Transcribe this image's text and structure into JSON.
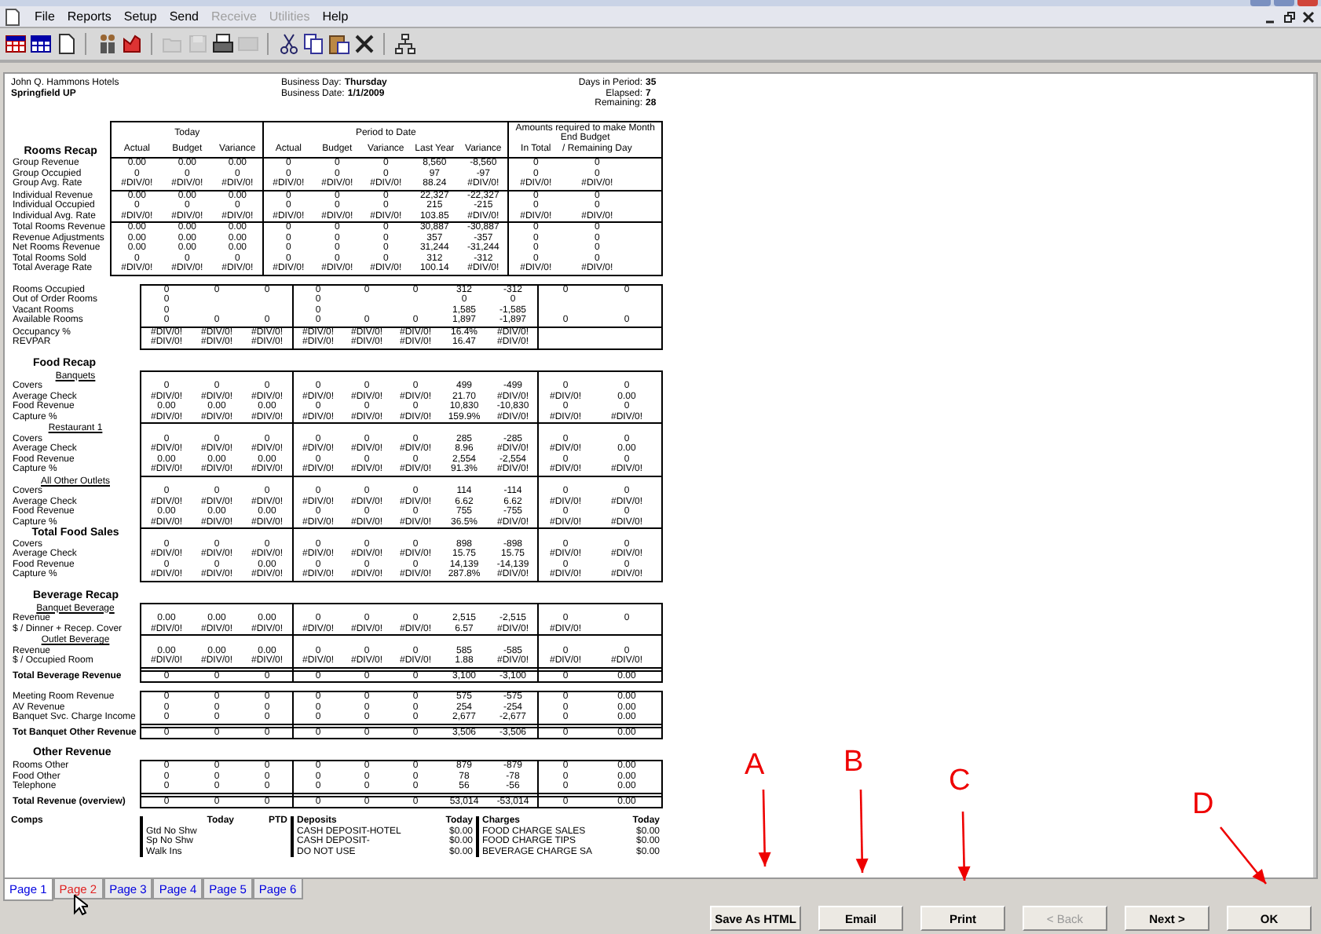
{
  "menu": [
    {
      "label": "File",
      "disabled": false
    },
    {
      "label": "Reports",
      "disabled": false
    },
    {
      "label": "Setup",
      "disabled": false
    },
    {
      "label": "Send",
      "disabled": false
    },
    {
      "label": "Receive",
      "disabled": true
    },
    {
      "label": "Utilities",
      "disabled": true
    },
    {
      "label": "Help",
      "disabled": false
    }
  ],
  "toolbar": [
    {
      "disabled": false
    },
    {
      "disabled": false
    },
    {
      "disabled": false
    },
    {
      "disabled": false
    },
    {
      "disabled": false
    },
    {
      "disabled": true
    },
    {
      "disabled": true
    },
    {
      "disabled": false
    },
    {
      "disabled": true
    },
    {
      "disabled": false
    },
    {
      "disabled": false
    },
    {
      "disabled": false
    },
    {
      "disabled": false
    },
    {
      "disabled": false
    }
  ],
  "report": {
    "company": "John Q. Hammons Hotels",
    "property": "Springfield UP",
    "business": [
      {
        "label": "Business Day:",
        "value": "Thursday"
      },
      {
        "label": "Business Date:",
        "value": "1/1/2009"
      }
    ],
    "period": [
      {
        "label": "Days in Period:",
        "value": "35"
      },
      {
        "label": "Elapsed:",
        "value": "7"
      },
      {
        "label": "Remaining:",
        "value": "28"
      }
    ],
    "column_groups": [
      {
        "title": "Today",
        "columns": [
          "Actual",
          "Budget",
          "Variance"
        ]
      },
      {
        "title": "Period to Date",
        "columns": [
          "Actual",
          "Budget",
          "Variance",
          "Last Year",
          "Variance"
        ]
      },
      {
        "title": "Amounts required to make Month End Budget",
        "columns": [
          "In Total",
          "/ Remaining Day"
        ]
      }
    ],
    "sections": [
      {
        "heading": "Rooms Recap",
        "groups": [
          {
            "kind": "rows",
            "rows": [
              {
                "label": "Group Revenue",
                "values": [
                  "0.00",
                  "0.00",
                  "0.00",
                  "0",
                  "0",
                  "0",
                  "8,560",
                  "-8,560",
                  "0",
                  "0"
                ]
              },
              {
                "label": "Group Occupied",
                "values": [
                  "0",
                  "0",
                  "0",
                  "0",
                  "0",
                  "0",
                  "97",
                  "-97",
                  "0",
                  "0"
                ]
              },
              {
                "label": "Group Avg. Rate",
                "values": [
                  "#DIV/0!",
                  "#DIV/0!",
                  "#DIV/0!",
                  "#DIV/0!",
                  "#DIV/0!",
                  "#DIV/0!",
                  "88.24",
                  "#DIV/0!",
                  "#DIV/0!",
                  "#DIV/0!"
                ]
              }
            ]
          },
          {
            "kind": "rows",
            "rows": [
              {
                "label": "Individual Revenue",
                "values": [
                  "0.00",
                  "0.00",
                  "0.00",
                  "0",
                  "0",
                  "0",
                  "22,327",
                  "-22,327",
                  "0",
                  "0"
                ]
              },
              {
                "label": "Individual Occupied",
                "values": [
                  "0",
                  "0",
                  "0",
                  "0",
                  "0",
                  "0",
                  "215",
                  "-215",
                  "0",
                  "0"
                ]
              },
              {
                "label": "Individual Avg. Rate",
                "values": [
                  "#DIV/0!",
                  "#DIV/0!",
                  "#DIV/0!",
                  "#DIV/0!",
                  "#DIV/0!",
                  "#DIV/0!",
                  "103.85",
                  "#DIV/0!",
                  "#DIV/0!",
                  "#DIV/0!"
                ]
              }
            ]
          },
          {
            "kind": "rows",
            "rows": [
              {
                "label": "Total Rooms Revenue",
                "values": [
                  "0.00",
                  "0.00",
                  "0.00",
                  "0",
                  "0",
                  "0",
                  "30,887",
                  "-30,887",
                  "0",
                  "0"
                ]
              },
              {
                "label": "Revenue Adjustments",
                "values": [
                  "0.00",
                  "0.00",
                  "0.00",
                  "0",
                  "0",
                  "0",
                  "357",
                  "-357",
                  "0",
                  "0"
                ]
              },
              {
                "label": "Net Rooms Revenue",
                "values": [
                  "0.00",
                  "0.00",
                  "0.00",
                  "0",
                  "0",
                  "0",
                  "31,244",
                  "-31,244",
                  "0",
                  "0"
                ]
              },
              {
                "label": "Total Rooms Sold",
                "values": [
                  "0",
                  "0",
                  "0",
                  "0",
                  "0",
                  "0",
                  "312",
                  "-312",
                  "0",
                  "0"
                ]
              },
              {
                "label": "Total Average Rate",
                "values": [
                  "#DIV/0!",
                  "#DIV/0!",
                  "#DIV/0!",
                  "#DIV/0!",
                  "#DIV/0!",
                  "#DIV/0!",
                  "100.14",
                  "#DIV/0!",
                  "#DIV/0!",
                  "#DIV/0!"
                ]
              }
            ]
          }
        ]
      },
      {
        "groups": [
          {
            "kind": "rows",
            "rows": [
              {
                "kind": "full",
                "label": "Rooms Occupied",
                "values": [
                  "0",
                  "0",
                  "0",
                  "0",
                  "0",
                  "0",
                  "312",
                  "-312",
                  "0",
                  "0"
                ]
              },
              {
                "kind": "actuals",
                "label": "Out of Order Rooms",
                "values": [
                  "0",
                  "0",
                  "0",
                  "0"
                ]
              },
              {
                "kind": "actuals",
                "label": "Vacant Rooms",
                "values": [
                  "0",
                  "0",
                  "1,585",
                  "-1,585"
                ]
              },
              {
                "kind": "full",
                "label": "Available Rooms",
                "values": [
                  "0",
                  "0",
                  "0",
                  "0",
                  "0",
                  "0",
                  "1,897",
                  "-1,897",
                  "0",
                  "0"
                ]
              }
            ]
          },
          {
            "kind": "rows",
            "rows": [
              {
                "label": "Occupancy %",
                "values": [
                  "#DIV/0!",
                  "#DIV/0!",
                  "#DIV/0!",
                  "#DIV/0!",
                  "#DIV/0!",
                  "#DIV/0!",
                  "16.4%",
                  "#DIV/0!"
                ]
              },
              {
                "label": "REVPAR",
                "values": [
                  "#DIV/0!",
                  "#DIV/0!",
                  "#DIV/0!",
                  "#DIV/0!",
                  "#DIV/0!",
                  "#DIV/0!",
                  "16.47",
                  "#DIV/0!"
                ]
              }
            ]
          }
        ]
      },
      {
        "heading": "Food Recap",
        "groups": [
          {
            "kind": "rows",
            "subheading": {
              "text": "Banquets",
              "kind": "underlined"
            },
            "rows": [
              {
                "label": "Covers",
                "values": [
                  "0",
                  "0",
                  "0",
                  "0",
                  "0",
                  "0",
                  "499",
                  "-499",
                  "0",
                  "0"
                ]
              },
              {
                "label": "Average Check",
                "values": [
                  "#DIV/0!",
                  "#DIV/0!",
                  "#DIV/0!",
                  "#DIV/0!",
                  "#DIV/0!",
                  "#DIV/0!",
                  "21.70",
                  "#DIV/0!",
                  "#DIV/0!",
                  "0.00"
                ]
              },
              {
                "label": "Food Revenue",
                "values": [
                  "0.00",
                  "0.00",
                  "0.00",
                  "0",
                  "0",
                  "0",
                  "10,830",
                  "-10,830",
                  "0",
                  "0"
                ]
              },
              {
                "label": "Capture %",
                "values": [
                  "#DIV/0!",
                  "#DIV/0!",
                  "#DIV/0!",
                  "#DIV/0!",
                  "#DIV/0!",
                  "#DIV/0!",
                  "159.9%",
                  "#DIV/0!",
                  "#DIV/0!",
                  "#DIV/0!"
                ]
              }
            ]
          },
          {
            "kind": "rows",
            "subheading": {
              "text": "Restaurant 1",
              "kind": "underlined"
            },
            "rows": [
              {
                "label": "Covers",
                "values": [
                  "0",
                  "0",
                  "0",
                  "0",
                  "0",
                  "0",
                  "285",
                  "-285",
                  "0",
                  "0"
                ]
              },
              {
                "label": "Average Check",
                "values": [
                  "#DIV/0!",
                  "#DIV/0!",
                  "#DIV/0!",
                  "#DIV/0!",
                  "#DIV/0!",
                  "#DIV/0!",
                  "8.96",
                  "#DIV/0!",
                  "#DIV/0!",
                  "0.00"
                ]
              },
              {
                "label": "Food Revenue",
                "values": [
                  "0.00",
                  "0.00",
                  "0.00",
                  "0",
                  "0",
                  "0",
                  "2,554",
                  "-2,554",
                  "0",
                  "0"
                ]
              },
              {
                "label": "Capture %",
                "values": [
                  "#DIV/0!",
                  "#DIV/0!",
                  "#DIV/0!",
                  "#DIV/0!",
                  "#DIV/0!",
                  "#DIV/0!",
                  "91.3%",
                  "#DIV/0!",
                  "#DIV/0!",
                  "#DIV/0!"
                ]
              }
            ]
          },
          {
            "kind": "rows",
            "subheading": {
              "text": "All Other Outlets",
              "kind": "underlined"
            },
            "rows": [
              {
                "label": "Covers",
                "values": [
                  "0",
                  "0",
                  "0",
                  "0",
                  "0",
                  "0",
                  "114",
                  "-114",
                  "0",
                  "0"
                ]
              },
              {
                "label": "Average Check",
                "values": [
                  "#DIV/0!",
                  "#DIV/0!",
                  "#DIV/0!",
                  "#DIV/0!",
                  "#DIV/0!",
                  "#DIV/0!",
                  "6.62",
                  "6.62",
                  "#DIV/0!",
                  "#DIV/0!"
                ]
              },
              {
                "label": "Food Revenue",
                "values": [
                  "0.00",
                  "0.00",
                  "0.00",
                  "0",
                  "0",
                  "0",
                  "755",
                  "-755",
                  "0",
                  "0"
                ]
              },
              {
                "label": "Capture %",
                "values": [
                  "#DIV/0!",
                  "#DIV/0!",
                  "#DIV/0!",
                  "#DIV/0!",
                  "#DIV/0!",
                  "#DIV/0!",
                  "36.5%",
                  "#DIV/0!",
                  "#DIV/0!",
                  "#DIV/0!"
                ]
              }
            ]
          },
          {
            "kind": "rows",
            "subheading": {
              "text": "Total Food Sales",
              "kind": "bold"
            },
            "rows": [
              {
                "label": "Covers",
                "values": [
                  "0",
                  "0",
                  "0",
                  "0",
                  "0",
                  "0",
                  "898",
                  "-898",
                  "0",
                  "0"
                ]
              },
              {
                "label": "Average Check",
                "values": [
                  "#DIV/0!",
                  "#DIV/0!",
                  "#DIV/0!",
                  "#DIV/0!",
                  "#DIV/0!",
                  "#DIV/0!",
                  "15.75",
                  "15.75",
                  "#DIV/0!",
                  "#DIV/0!"
                ]
              },
              {
                "label": "Food Revenue",
                "values": [
                  "0",
                  "0",
                  "0.00",
                  "0",
                  "0",
                  "0",
                  "14,139",
                  "-14,139",
                  "0",
                  "0"
                ]
              },
              {
                "label": "Capture %",
                "values": [
                  "#DIV/0!",
                  "#DIV/0!",
                  "#DIV/0!",
                  "#DIV/0!",
                  "#DIV/0!",
                  "#DIV/0!",
                  "287.8%",
                  "#DIV/0!",
                  "#DIV/0!",
                  "#DIV/0!"
                ]
              }
            ]
          }
        ]
      },
      {
        "heading": "Beverage Recap",
        "groups": [
          {
            "kind": "rows",
            "subheading": {
              "text": "Banquet Beverage",
              "kind": "underlined"
            },
            "rows": [
              {
                "label": "Revenue",
                "values": [
                  "0.00",
                  "0.00",
                  "0.00",
                  "0",
                  "0",
                  "0",
                  "2,515",
                  "-2,515",
                  "0",
                  "0"
                ]
              },
              {
                "label": "$ / Dinner + Recep. Cover",
                "values": [
                  "#DIV/0!",
                  "#DIV/0!",
                  "#DIV/0!",
                  "#DIV/0!",
                  "#DIV/0!",
                  "#DIV/0!",
                  "6.57",
                  "#DIV/0!",
                  "#DIV/0!"
                ]
              }
            ]
          },
          {
            "kind": "rows",
            "subheading": {
              "text": "Outlet Beverage",
              "kind": "underlined"
            },
            "rows": [
              {
                "label": "Revenue",
                "values": [
                  "0.00",
                  "0.00",
                  "0.00",
                  "0",
                  "0",
                  "0",
                  "585",
                  "-585",
                  "0",
                  "0"
                ]
              },
              {
                "label": "$ / Occupied Room",
                "values": [
                  "#DIV/0!",
                  "#DIV/0!",
                  "#DIV/0!",
                  "#DIV/0!",
                  "#DIV/0!",
                  "#DIV/0!",
                  "1.88",
                  "#DIV/0!",
                  "#DIV/0!",
                  "#DIV/0!"
                ]
              }
            ]
          },
          {
            "kind": "total",
            "rows": [
              {
                "label": "Total Beverage Revenue",
                "values": [
                  "0",
                  "0",
                  "0",
                  "0",
                  "0",
                  "0",
                  "3,100",
                  "-3,100",
                  "0",
                  "0.00"
                ]
              }
            ]
          }
        ]
      },
      {
        "groups": [
          {
            "kind": "rows",
            "rows": [
              {
                "label": "Meeting Room Revenue",
                "values": [
                  "0",
                  "0",
                  "0",
                  "0",
                  "0",
                  "0",
                  "575",
                  "-575",
                  "0",
                  "0.00"
                ]
              },
              {
                "label": "AV Revenue",
                "values": [
                  "0",
                  "0",
                  "0",
                  "0",
                  "0",
                  "0",
                  "254",
                  "-254",
                  "0",
                  "0.00"
                ]
              },
              {
                "label": "Banquet Svc. Charge Income",
                "values": [
                  "0",
                  "0",
                  "0",
                  "0",
                  "0",
                  "0",
                  "2,677",
                  "-2,677",
                  "0",
                  "0.00"
                ]
              }
            ]
          },
          {
            "kind": "total",
            "rows": [
              {
                "label": "Tot Banquet Other Revenue",
                "values": [
                  "0",
                  "0",
                  "0",
                  "0",
                  "0",
                  "0",
                  "3,506",
                  "-3,506",
                  "0",
                  "0.00"
                ]
              }
            ]
          }
        ]
      },
      {
        "heading": "Other Revenue",
        "groups": [
          {
            "kind": "rows",
            "rows": [
              {
                "label": "Rooms Other",
                "values": [
                  "0",
                  "0",
                  "0",
                  "0",
                  "0",
                  "0",
                  "879",
                  "-879",
                  "0",
                  "0.00"
                ]
              },
              {
                "label": "Food Other",
                "values": [
                  "0",
                  "0",
                  "0",
                  "0",
                  "0",
                  "0",
                  "78",
                  "-78",
                  "0",
                  "0.00"
                ]
              },
              {
                "label": "Telephone",
                "values": [
                  "0",
                  "0",
                  "0",
                  "0",
                  "0",
                  "0",
                  "56",
                  "-56",
                  "0",
                  "0.00"
                ]
              }
            ]
          },
          {
            "kind": "total",
            "rows": [
              {
                "label": "Total Revenue (overview)",
                "values": [
                  "0",
                  "0",
                  "0",
                  "0",
                  "0",
                  "0",
                  "53,014",
                  "-53,014",
                  "0",
                  "0.00"
                ]
              }
            ]
          }
        ]
      }
    ],
    "comps": {
      "title": "Comps",
      "headers": [
        "Today",
        "PTD"
      ],
      "rows": [
        "Gtd No Shw",
        "Sp No Shw",
        "Walk Ins"
      ]
    },
    "ledgers": [
      {
        "title": "Deposits",
        "header": "Today",
        "rows": [
          {
            "name": "CASH DEPOSIT-HOTEL",
            "value": "$0.00"
          },
          {
            "name": "CASH DEPOSIT-",
            "value": "$0.00"
          },
          {
            "name": "DO NOT USE",
            "value": "$0.00"
          }
        ]
      },
      {
        "title": "Charges",
        "header": "Today",
        "rows": [
          {
            "name": "FOOD CHARGE SALES",
            "value": "$0.00"
          },
          {
            "name": "FOOD CHARGE TIPS",
            "value": "$0.00"
          },
          {
            "name": "BEVERAGE CHARGE SA",
            "value": "$0.00"
          }
        ]
      }
    ]
  },
  "pages": [
    {
      "label": "Page 1",
      "selected": true,
      "hovered": false
    },
    {
      "label": "Page 2",
      "selected": false,
      "hovered": true
    },
    {
      "label": "Page 3",
      "selected": false,
      "hovered": false
    },
    {
      "label": "Page 4",
      "selected": false,
      "hovered": false
    },
    {
      "label": "Page 5",
      "selected": false,
      "hovered": false
    },
    {
      "label": "Page 6",
      "selected": false,
      "hovered": false
    }
  ],
  "buttons": [
    {
      "label": "Save As HTML",
      "disabled": false
    },
    {
      "label": "Email",
      "disabled": false
    },
    {
      "label": "Print",
      "disabled": false
    },
    {
      "label": "< Back",
      "disabled": true
    },
    {
      "label": "Next >",
      "disabled": false
    },
    {
      "label": "OK",
      "disabled": false
    }
  ],
  "annotations": [
    {
      "label": "A"
    },
    {
      "label": "B"
    },
    {
      "label": "C"
    },
    {
      "label": "D"
    }
  ]
}
